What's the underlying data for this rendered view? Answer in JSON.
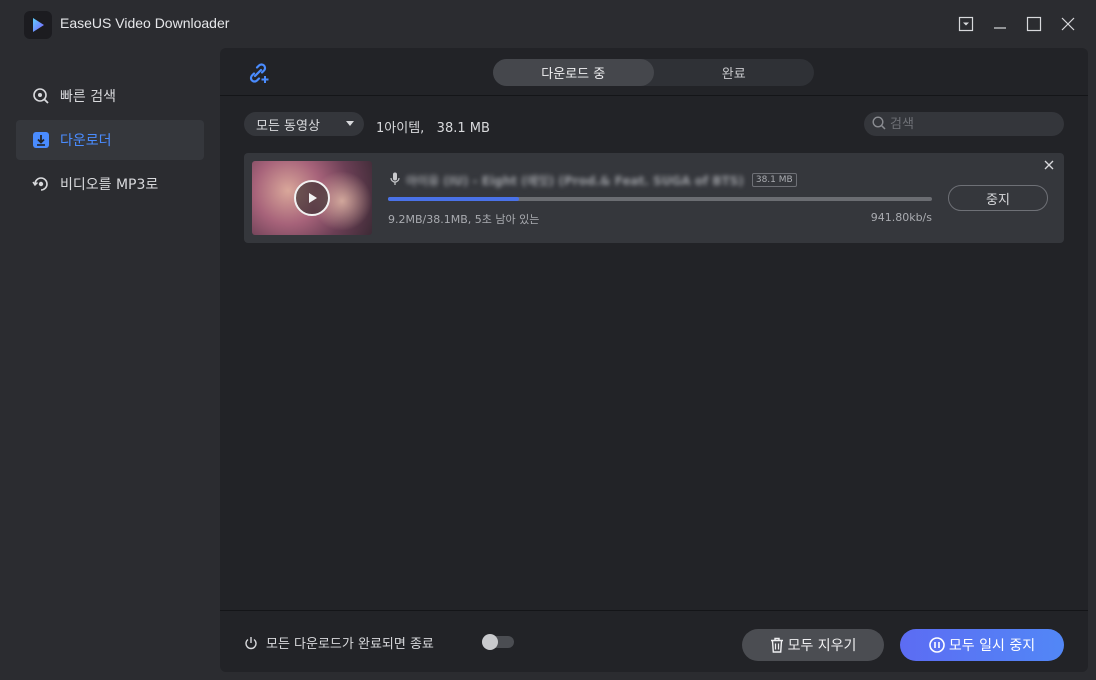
{
  "app": {
    "title": "EaseUS Video Downloader",
    "accent_color": "#4a8cff"
  },
  "window_controls": {
    "menu_icon": "dropdown-menu-icon",
    "minimize_icon": "minimize-icon",
    "maximize_icon": "maximize-icon",
    "close_icon": "close-icon"
  },
  "sidebar": {
    "items": [
      {
        "label": "빠른 검색",
        "icon": "quick-search-icon",
        "active": false
      },
      {
        "label": "다운로더",
        "icon": "downloader-icon",
        "active": true
      },
      {
        "label": "비디오를 MP3로",
        "icon": "video-to-mp3-icon",
        "active": false
      }
    ]
  },
  "topbar": {
    "link_icon": "add-link-icon",
    "tabs": [
      {
        "label": "다운로드 중",
        "active": true
      },
      {
        "label": "완료",
        "active": false
      }
    ]
  },
  "filter": {
    "select_value": "모든 동영상",
    "item_count": "1아이템,   38.1 MB",
    "search_placeholder": "검색"
  },
  "download": {
    "title": "아이유 (IU) - Eight (에잇) (Prod.& Feat. SUGA of BTS)",
    "size_badge": "38.1 MB",
    "progress_fraction": 0.24,
    "progress_text": "9.2MB/38.1MB, 5초 남아 있는",
    "speed": "941.80kb/s",
    "stop_label": "중지"
  },
  "footer": {
    "auto_shutdown_label": "모든 다운로드가 완료되면 종료",
    "auto_shutdown_on": false,
    "clear_all_label": "모두 지우기",
    "pause_all_label": "모두 일시 중지"
  }
}
